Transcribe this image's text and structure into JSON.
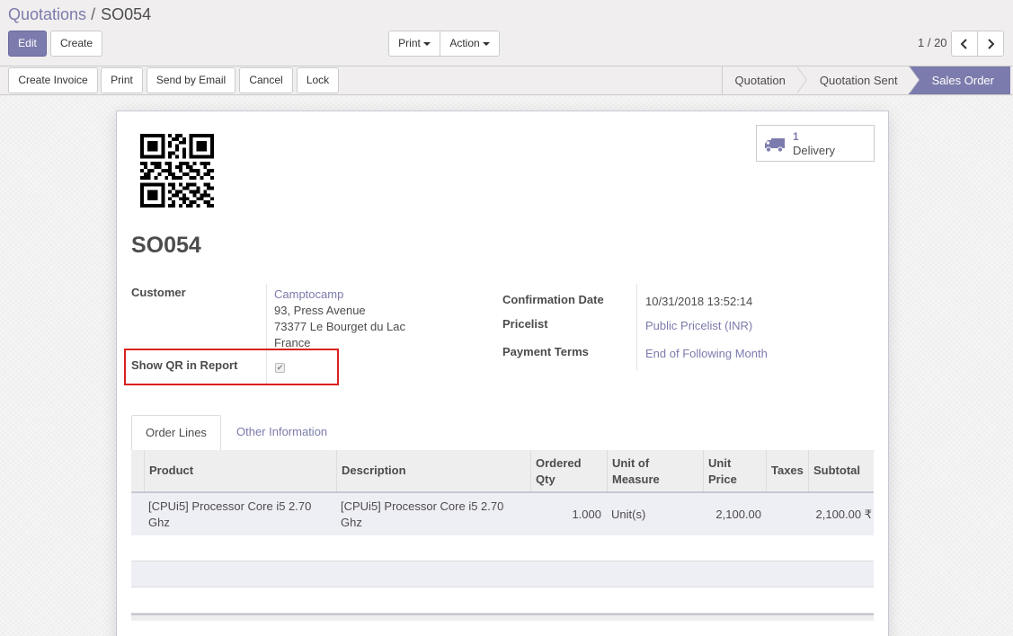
{
  "breadcrumb": {
    "parent": "Quotations",
    "separator": "/",
    "current": "SO054"
  },
  "toolbar": {
    "edit_label": "Edit",
    "create_label": "Create",
    "print_label": "Print",
    "action_label": "Action"
  },
  "pager": {
    "value": "1 / 20"
  },
  "actions": {
    "create_invoice": "Create Invoice",
    "print": "Print",
    "send_email": "Send by Email",
    "cancel": "Cancel",
    "lock": "Lock"
  },
  "status": {
    "stages": [
      "Quotation",
      "Quotation Sent",
      "Sales Order"
    ],
    "active": "Sales Order"
  },
  "smart_button": {
    "value": "1",
    "label": "Delivery",
    "icon": "truck-icon"
  },
  "record": {
    "name": "SO054",
    "customer_label": "Customer",
    "customer_name": "Camptocamp",
    "customer_street": "93, Press Avenue",
    "customer_city": "73377 Le Bourget du Lac",
    "customer_country": "France",
    "show_qr_label": "Show QR in Report",
    "show_qr_value": true,
    "confirmation_date_label": "Confirmation Date",
    "confirmation_date": "10/31/2018 13:52:14",
    "pricelist_label": "Pricelist",
    "pricelist": "Public Pricelist (INR)",
    "payment_terms_label": "Payment Terms",
    "payment_terms": "End of Following Month"
  },
  "tabs": {
    "order_lines": "Order Lines",
    "other_info": "Other Information"
  },
  "table": {
    "headers": {
      "product": "Product",
      "description": "Description",
      "ordered_qty_1": "Ordered",
      "ordered_qty_2": "Qty",
      "uom_1": "Unit of",
      "uom_2": "Measure",
      "unit_price_1": "Unit",
      "unit_price_2": "Price",
      "taxes": "Taxes",
      "subtotal": "Subtotal"
    },
    "rows": [
      {
        "product_1": "[CPUi5] Processor Core i5 2.70",
        "product_2": "Ghz",
        "description_1": "[CPUi5] Processor Core i5 2.70",
        "description_2": "Ghz",
        "qty": "1.000",
        "uom": "Unit(s)",
        "price": "2,100.00",
        "taxes": "",
        "subtotal": "2,100.00 ₹"
      }
    ]
  },
  "colors": {
    "accent": "#7c7bad",
    "highlight": "#d9201f"
  }
}
